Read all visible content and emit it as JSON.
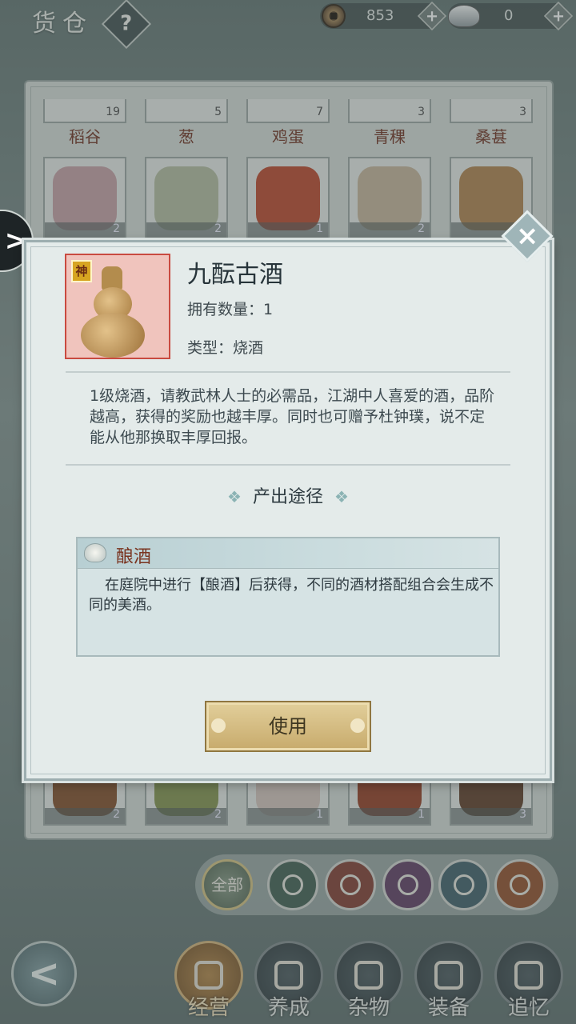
{
  "header": {
    "title": "货仓",
    "help_label": "?",
    "coins": "853",
    "silver": "0",
    "plus": "+"
  },
  "grid": {
    "top_row": [
      {
        "label": "稻谷",
        "count": "19"
      },
      {
        "label": "葱",
        "count": "5"
      },
      {
        "label": "鸡蛋",
        "count": "7"
      },
      {
        "label": "青稞",
        "count": "3"
      },
      {
        "label": "桑葚",
        "count": "3"
      }
    ],
    "second_row": [
      {
        "name": "plum-branch",
        "count": "2",
        "color": "#c9a7ab"
      },
      {
        "name": "herb-branch",
        "count": "2",
        "color": "#b9c1a6"
      },
      {
        "name": "chili-pile",
        "count": "1",
        "color": "#c0533a"
      },
      {
        "name": "mushroom-pile",
        "count": "2",
        "color": "#c9b8a0"
      },
      {
        "name": "dried-food",
        "count": "2",
        "color": "#b58a5a"
      }
    ],
    "bottom_row": [
      {
        "name": "rope-coil",
        "count": "2",
        "color": "#8a5a38"
      },
      {
        "name": "vegetable-dish",
        "count": "2",
        "color": "#8d9a5a"
      },
      {
        "name": "dumpling-plate",
        "count": "1",
        "color": "#d7c8c0"
      },
      {
        "name": "money-bag",
        "count": "1",
        "color": "#9c4a32"
      },
      {
        "name": "wood-board",
        "count": "3",
        "color": "#6a4a36"
      }
    ]
  },
  "dialog": {
    "badge": "神",
    "name": "九酝古酒",
    "count_text": "拥有数量：1",
    "type_text": "类型：烧酒",
    "description": "1级烧酒，请教武林人士的必需品，江湖中人喜爱的酒，品阶越高，获得的奖励也越丰厚。同时也可赠予杜钟璞，说不定能从他那换取丰厚回报。",
    "section_title": "产出途径",
    "source": {
      "title": "酿酒",
      "text": "在庭院中进行【酿酒】后获得，不同的酒材搭配组合会生成不同的美酒。"
    },
    "use_label": "使用"
  },
  "categories": {
    "all_label": "全部",
    "items": [
      "plant-icon",
      "food-icon",
      "jar-icon",
      "mortar-icon",
      "tool-icon"
    ],
    "colors": [
      "#4f6a5e",
      "#8a4b3f",
      "#6b4a6e",
      "#4d6a73",
      "#9a5b3a"
    ]
  },
  "nav": {
    "back_label": "<",
    "items": [
      {
        "label": "经营",
        "active": true
      },
      {
        "label": "养成",
        "active": false
      },
      {
        "label": "杂物",
        "active": false
      },
      {
        "label": "装备",
        "active": false
      },
      {
        "label": "追忆",
        "active": false
      }
    ]
  },
  "colors": {
    "accent_red": "#c94a40",
    "gold_button": "#c7aa6b",
    "panel_bg": "#e4ebea"
  }
}
